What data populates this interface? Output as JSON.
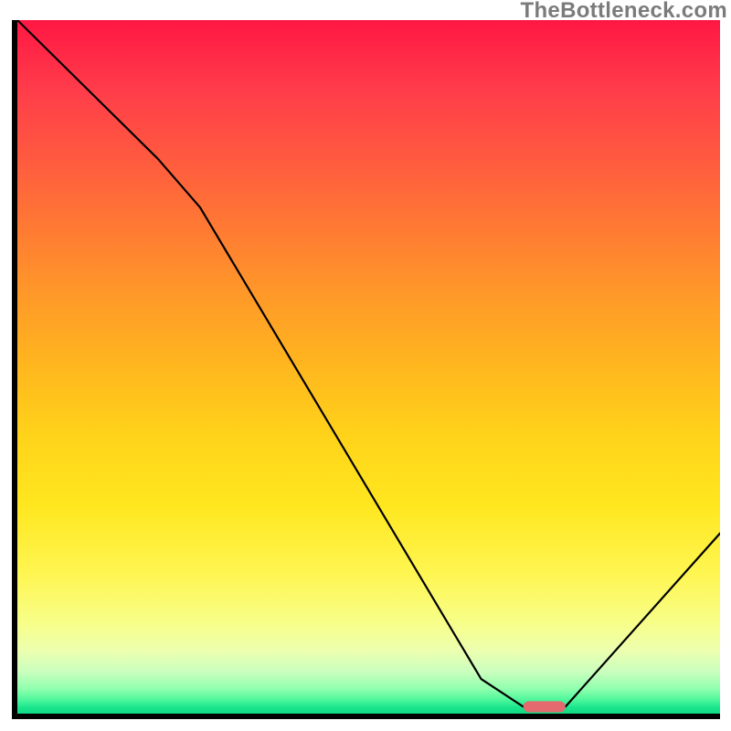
{
  "watermark": "TheBottleneck.com",
  "chart_data": {
    "type": "line",
    "title": "",
    "xlabel": "",
    "ylabel": "",
    "x_range": [
      0,
      100
    ],
    "y_range": [
      0,
      100
    ],
    "series": [
      {
        "name": "bottleneck-curve",
        "x": [
          0,
          20,
          26,
          66,
          72,
          78,
          100
        ],
        "y": [
          100,
          80,
          73,
          5,
          1,
          1,
          26
        ]
      }
    ],
    "marker": {
      "name": "bottleneck-point",
      "x": 75,
      "y": 1,
      "width_pct": 6,
      "height_pct": 1.6,
      "color": "#e46a6f"
    },
    "gradient_stops": [
      {
        "pct": 0,
        "color": "#ff1744"
      },
      {
        "pct": 10,
        "color": "#ff3c4a"
      },
      {
        "pct": 20,
        "color": "#ff5a3f"
      },
      {
        "pct": 30,
        "color": "#ff7a33"
      },
      {
        "pct": 40,
        "color": "#ff9a28"
      },
      {
        "pct": 50,
        "color": "#ffb71e"
      },
      {
        "pct": 60,
        "color": "#ffd31a"
      },
      {
        "pct": 70,
        "color": "#ffe71f"
      },
      {
        "pct": 80,
        "color": "#fff653"
      },
      {
        "pct": 87,
        "color": "#f7ff8a"
      },
      {
        "pct": 91,
        "color": "#ecffb0"
      },
      {
        "pct": 94,
        "color": "#c9ffbe"
      },
      {
        "pct": 96.5,
        "color": "#8dffad"
      },
      {
        "pct": 98.2,
        "color": "#46f59a"
      },
      {
        "pct": 99.1,
        "color": "#1be58c"
      },
      {
        "pct": 100,
        "color": "#0fd983"
      }
    ]
  }
}
